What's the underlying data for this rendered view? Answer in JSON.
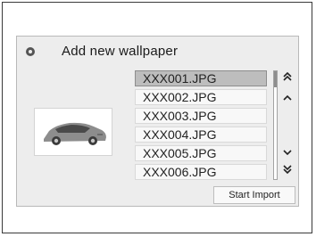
{
  "window": {
    "title": "Add new wallpaper",
    "icon": "gear-icon"
  },
  "preview": {
    "description_icon": "car-thumbnail"
  },
  "files": [
    {
      "name": "XXX001.JPG",
      "selected": true
    },
    {
      "name": "XXX002.JPG",
      "selected": false
    },
    {
      "name": "XXX003.JPG",
      "selected": false
    },
    {
      "name": "XXX004.JPG",
      "selected": false
    },
    {
      "name": "XXX005.JPG",
      "selected": false
    },
    {
      "name": "XXX006.JPG",
      "selected": false
    }
  ],
  "scroll": {
    "up_page_icon": "double-chevron-up-icon",
    "up_icon": "chevron-up-icon",
    "down_icon": "chevron-down-icon",
    "down_page_icon": "double-chevron-down-icon",
    "thumb_position": 0.0
  },
  "actions": {
    "start_import_label": "Start Import"
  }
}
